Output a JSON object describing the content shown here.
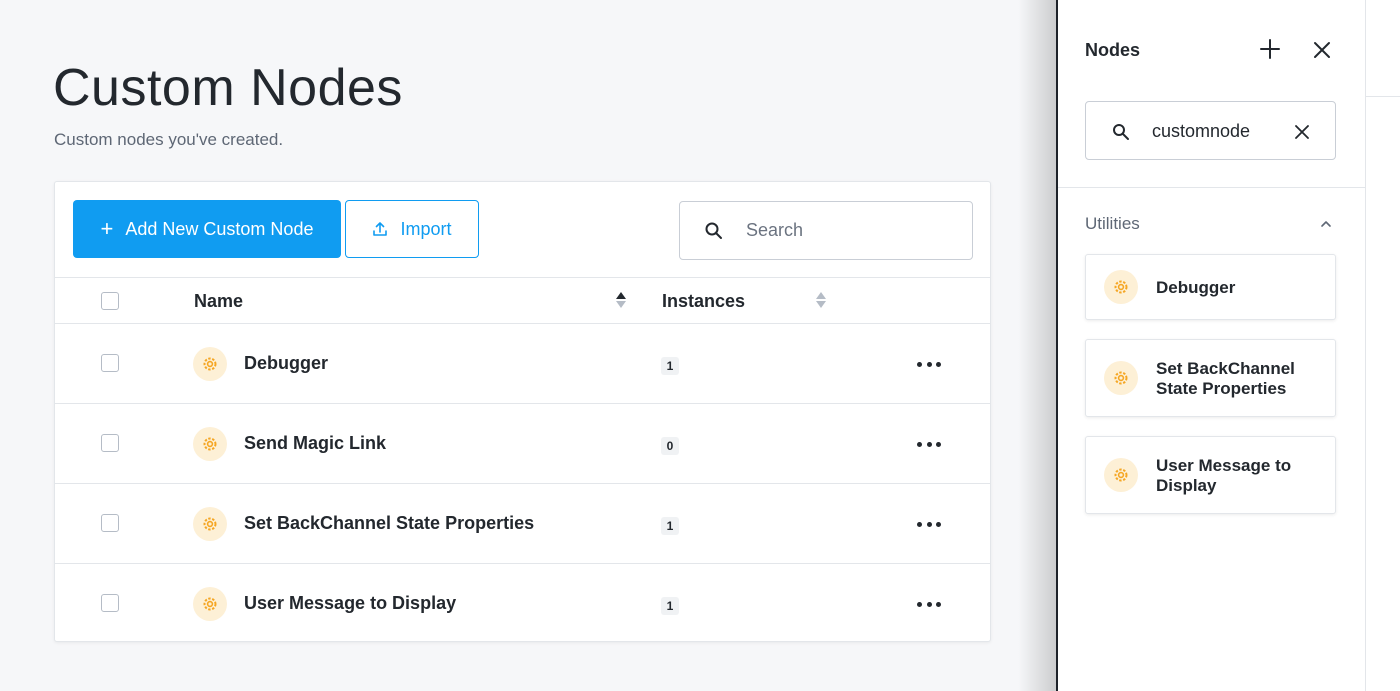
{
  "page": {
    "title": "Custom Nodes",
    "subtitle": "Custom nodes you've created."
  },
  "toolbar": {
    "add_label": "Add New Custom Node",
    "import_label": "Import",
    "search_placeholder": "Search"
  },
  "table": {
    "columns": [
      "Name",
      "Instances"
    ],
    "rows": [
      {
        "name": "Debugger",
        "instances": "1"
      },
      {
        "name": "Send Magic Link",
        "instances": "0"
      },
      {
        "name": "Set BackChannel State Properties",
        "instances": "1"
      },
      {
        "name": "User Message to Display",
        "instances": "1"
      }
    ]
  },
  "panel": {
    "title": "Nodes",
    "search_value": "customnode",
    "section": "Utilities",
    "nodes": [
      {
        "label_line1": "Debugger",
        "label_line2": ""
      },
      {
        "label_line1": "Set BackChannel",
        "label_line2": "State Properties"
      },
      {
        "label_line1": "User Message to",
        "label_line2": "Display"
      }
    ]
  },
  "colors": {
    "accent": "#109cf1",
    "node_icon": "#f5a623",
    "node_badge_bg": "#fdf0d6"
  },
  "icons": {
    "add": "plus-icon",
    "import": "upload-icon",
    "search": "search-icon",
    "node": "gear-icon",
    "more": "more-horizontal-icon",
    "close": "close-icon",
    "collapse": "chevron-up-icon",
    "sort": "sort-icon"
  }
}
